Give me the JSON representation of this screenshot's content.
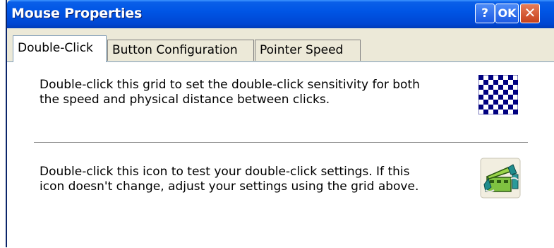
{
  "window": {
    "title": "Mouse Properties",
    "help_label": "?",
    "ok_label": "OK",
    "close_label": "✕"
  },
  "tabs": [
    {
      "label": "Double-Click",
      "active": true
    },
    {
      "label": "Button Configuration",
      "active": false
    },
    {
      "label": "Pointer Speed",
      "active": false
    }
  ],
  "double_click": {
    "grid_text_line1": "Double-click this grid to set the double-click sensitivity for both",
    "grid_text_line2": "the speed and physical distance between clicks.",
    "test_text_line1": "Double-click this icon to test your double-click settings. If this",
    "test_text_line2": "icon doesn't change, adjust your settings using the grid above.",
    "grid_icon": "checkerboard-grid-icon",
    "test_icon": "clapperboard-test-icon"
  },
  "colors": {
    "titlebar": "#0055e5",
    "grid": "#000080",
    "close": "#c6411c"
  }
}
